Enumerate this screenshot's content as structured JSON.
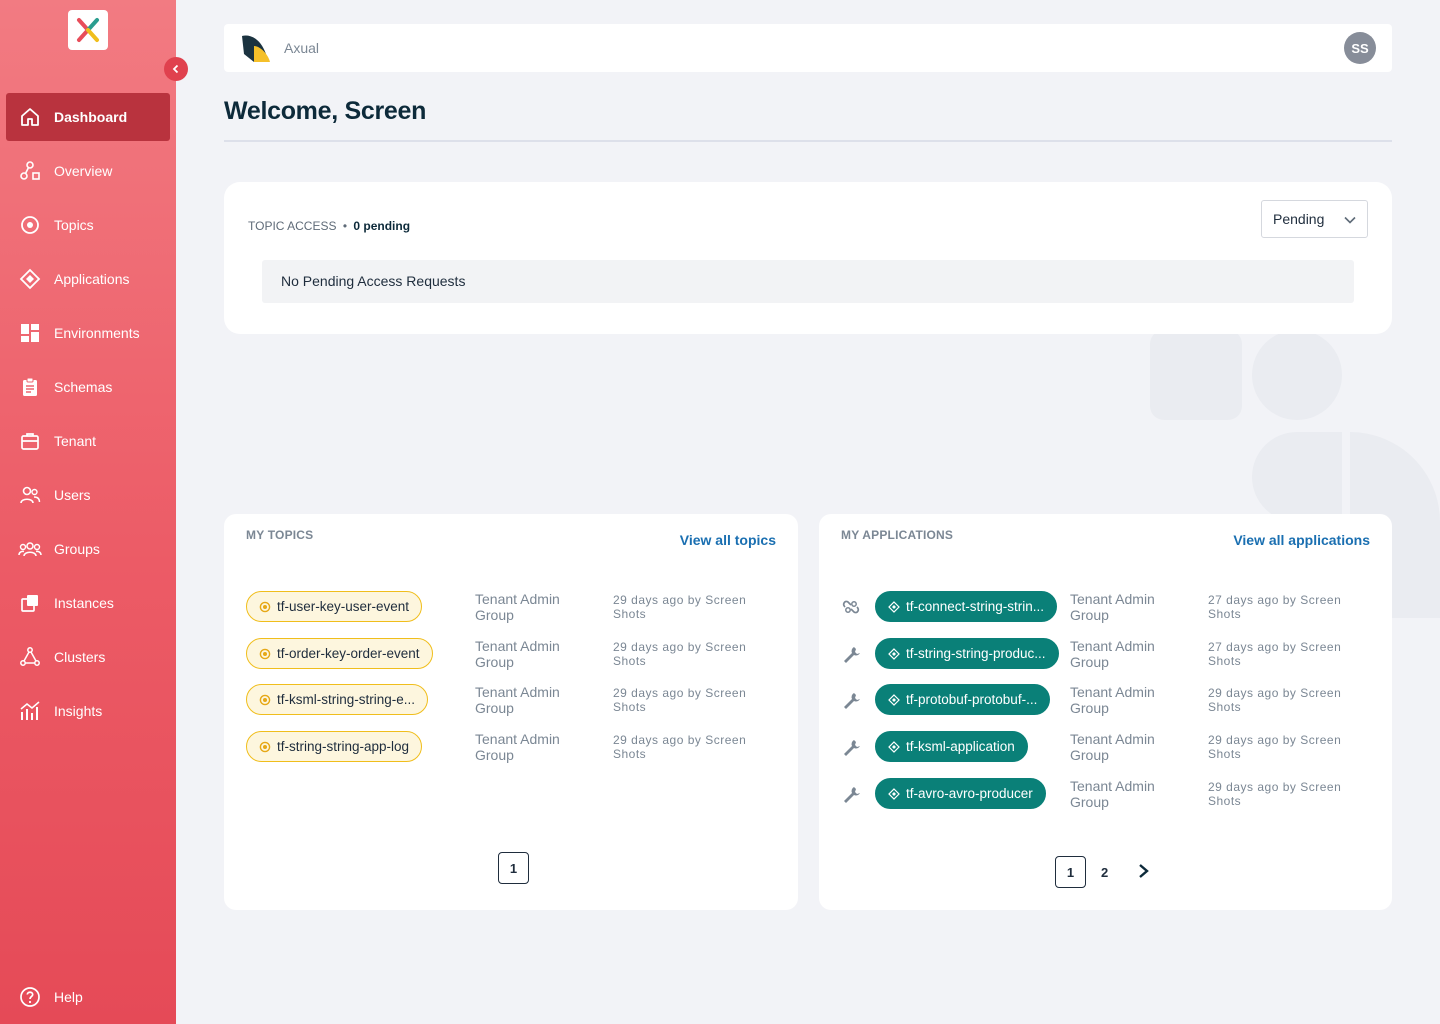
{
  "sidebar": {
    "items": [
      {
        "label": "Dashboard",
        "icon": "home-icon",
        "active": true
      },
      {
        "label": "Overview",
        "icon": "overview-icon"
      },
      {
        "label": "Topics",
        "icon": "topic-icon"
      },
      {
        "label": "Applications",
        "icon": "application-icon"
      },
      {
        "label": "Environments",
        "icon": "environments-icon"
      },
      {
        "label": "Schemas",
        "icon": "schema-icon"
      },
      {
        "label": "Tenant",
        "icon": "tenant-icon"
      },
      {
        "label": "Users",
        "icon": "users-icon"
      },
      {
        "label": "Groups",
        "icon": "groups-icon"
      },
      {
        "label": "Instances",
        "icon": "instances-icon"
      },
      {
        "label": "Clusters",
        "icon": "clusters-icon"
      },
      {
        "label": "Insights",
        "icon": "insights-icon"
      }
    ],
    "help": "Help"
  },
  "header": {
    "tenant_name": "Axual",
    "avatar_initials": "SS"
  },
  "welcome": "Welcome, Screen",
  "topic_access": {
    "title": "TOPIC ACCESS",
    "separator": "•",
    "pending_count": "0 pending",
    "filter_value": "Pending",
    "empty_message": "No Pending Access Requests"
  },
  "my_topics": {
    "title": "MY TOPICS",
    "view_all": "View all topics",
    "rows": [
      {
        "name": "tf-user-key-user-event",
        "owner": "Tenant Admin Group",
        "meta": "29 days ago by Screen Shots"
      },
      {
        "name": "tf-order-key-order-event",
        "owner": "Tenant Admin Group",
        "meta": "29 days ago by Screen Shots"
      },
      {
        "name": "tf-ksml-string-string-e...",
        "owner": "Tenant Admin Group",
        "meta": "29 days ago by Screen Shots"
      },
      {
        "name": "tf-string-string-app-log",
        "owner": "Tenant Admin Group",
        "meta": "29 days ago by Screen Shots"
      }
    ],
    "pages": [
      "1"
    ]
  },
  "my_applications": {
    "title": "MY APPLICATIONS",
    "view_all": "View all applications",
    "rows": [
      {
        "name": "tf-connect-string-strin...",
        "type_icon": "connector-icon",
        "owner": "Tenant Admin Group",
        "meta": "27 days ago by Screen Shots"
      },
      {
        "name": "tf-string-string-produc...",
        "type_icon": "wrench-icon",
        "owner": "Tenant Admin Group",
        "meta": "27 days ago by Screen Shots"
      },
      {
        "name": "tf-protobuf-protobuf-...",
        "type_icon": "wrench-icon",
        "owner": "Tenant Admin Group",
        "meta": "29 days ago by Screen Shots"
      },
      {
        "name": "tf-ksml-application",
        "type_icon": "wrench-icon",
        "owner": "Tenant Admin Group",
        "meta": "29 days ago by Screen Shots"
      },
      {
        "name": "tf-avro-avro-producer",
        "type_icon": "wrench-icon",
        "owner": "Tenant Admin Group",
        "meta": "29 days ago by Screen Shots"
      }
    ],
    "pages": [
      "1",
      "2"
    ],
    "next": ">"
  },
  "colors": {
    "sidebar_top": "#f27b82",
    "sidebar_bottom": "#e54a57",
    "active_nav": "#b9333e",
    "topic_border": "#f0be1c",
    "app_pill": "#0a8078",
    "link": "#1a6fb1"
  }
}
